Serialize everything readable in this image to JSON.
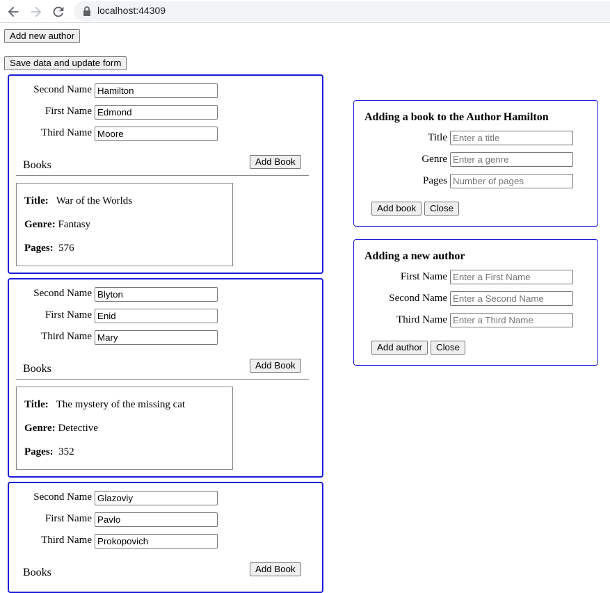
{
  "browser": {
    "url": "localhost:44309"
  },
  "toolbar": {
    "add_author_label": "Add new author",
    "save_label": "Save data and update form"
  },
  "authors": [
    {
      "second_name_label": "Second Name",
      "second_name": "Hamilton",
      "first_name_label": "First Name",
      "first_name": "Edmond",
      "third_name_label": "Third Name",
      "third_name": "Moore",
      "books_label": "Books",
      "add_book_label": "Add Book",
      "book": {
        "title_label": "Title:",
        "title": "War of the Worlds",
        "genre_label": "Genre:",
        "genre": "Fantasy",
        "pages_label": "Pages:",
        "pages": "576"
      }
    },
    {
      "second_name_label": "Second Name",
      "second_name": "Blyton",
      "first_name_label": "First Name",
      "first_name": "Enid",
      "third_name_label": "Third Name",
      "third_name": "Mary",
      "books_label": "Books",
      "add_book_label": "Add Book",
      "book": {
        "title_label": "Title:",
        "title": "The mystery of the missing cat",
        "genre_label": "Genre:",
        "genre": "Detective",
        "pages_label": "Pages:",
        "pages": "352"
      }
    },
    {
      "second_name_label": "Second Name",
      "second_name": "Glazoviy",
      "first_name_label": "First Name",
      "first_name": "Pavlo",
      "third_name_label": "Third Name",
      "third_name": "Prokopovich",
      "books_label": "Books",
      "add_book_label": "Add Book"
    }
  ],
  "add_book_panel": {
    "title": "Adding a book to the Author Hamilton",
    "title_label": "Title",
    "title_placeholder": "Enter a title",
    "genre_label": "Genre",
    "genre_placeholder": "Enter a genre",
    "pages_label": "Pages",
    "pages_placeholder": "Number of pages",
    "add_label": "Add book",
    "close_label": "Close"
  },
  "add_author_panel": {
    "title": "Adding a new author",
    "first_label": "First Name",
    "first_placeholder": "Enter a First Name",
    "second_label": "Second Name",
    "second_placeholder": "Enter a Second Name",
    "third_label": "Third Name",
    "third_placeholder": "Enter a Third Name",
    "add_label": "Add author",
    "close_label": "Close"
  },
  "colors": {
    "card_border": "#1a1adb",
    "button_bg": "#efefef"
  },
  "icons": [
    "back-arrow-icon",
    "forward-arrow-icon",
    "reload-icon",
    "lock-icon"
  ]
}
